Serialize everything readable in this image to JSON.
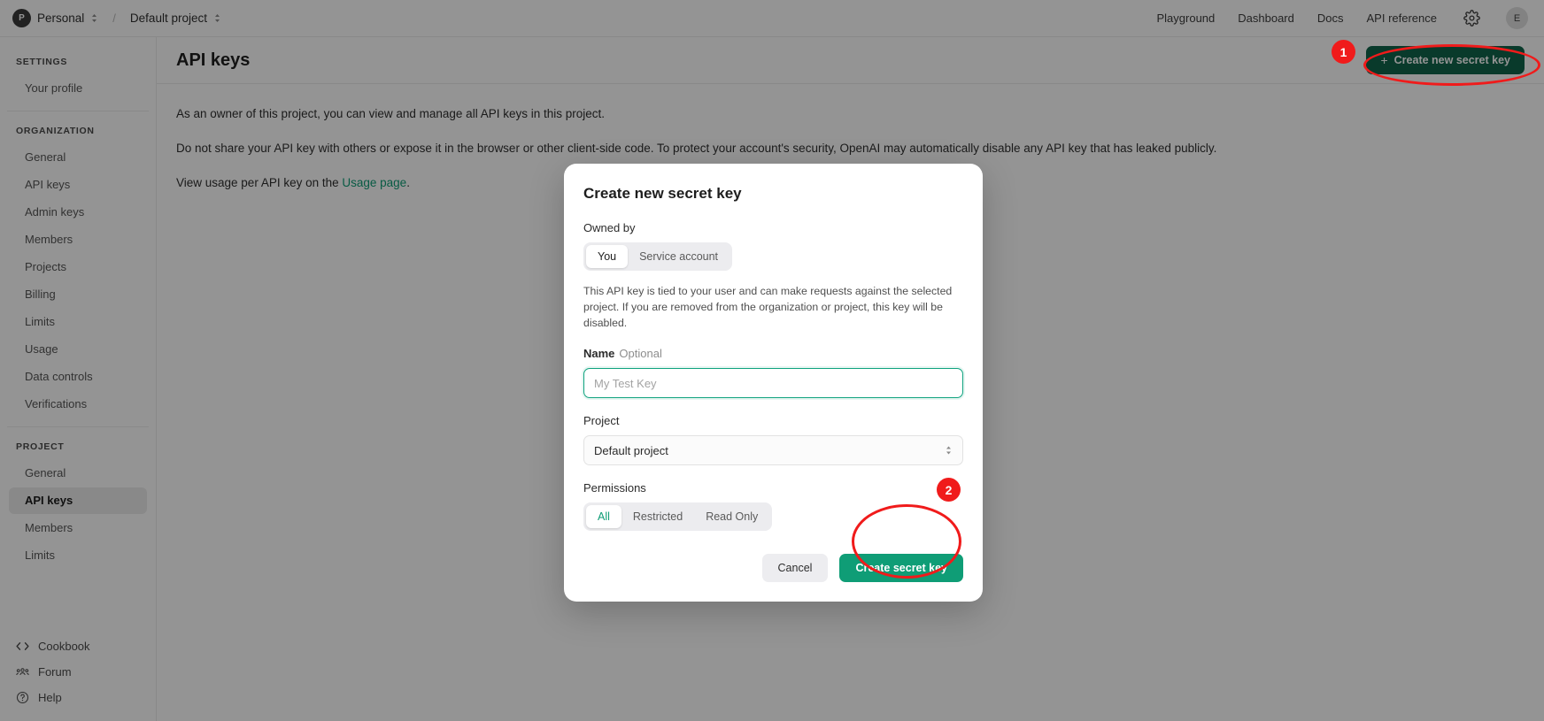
{
  "topbar": {
    "org_avatar_letter": "P",
    "org_name": "Personal",
    "separator": "/",
    "project_name": "Default project",
    "nav": [
      {
        "label": "Playground"
      },
      {
        "label": "Dashboard"
      },
      {
        "label": "Docs"
      },
      {
        "label": "API reference"
      }
    ],
    "settings_icon": "gear-icon",
    "user_avatar_letter": "E"
  },
  "sidebar": {
    "settings_title": "SETTINGS",
    "settings_items": [
      {
        "label": "Your profile"
      }
    ],
    "organization_title": "ORGANIZATION",
    "organization_items": [
      {
        "label": "General"
      },
      {
        "label": "API keys"
      },
      {
        "label": "Admin keys"
      },
      {
        "label": "Members"
      },
      {
        "label": "Projects"
      },
      {
        "label": "Billing"
      },
      {
        "label": "Limits"
      },
      {
        "label": "Usage"
      },
      {
        "label": "Data controls"
      },
      {
        "label": "Verifications"
      }
    ],
    "project_title": "PROJECT",
    "project_items": [
      {
        "label": "General",
        "active": false
      },
      {
        "label": "API keys",
        "active": true
      },
      {
        "label": "Members",
        "active": false
      },
      {
        "label": "Limits",
        "active": false
      }
    ],
    "footer_items": [
      {
        "label": "Cookbook",
        "icon": "code-icon"
      },
      {
        "label": "Forum",
        "icon": "people-icon"
      },
      {
        "label": "Help",
        "icon": "question-circle-icon"
      }
    ]
  },
  "main": {
    "title": "API keys",
    "create_button": {
      "label": "Create new secret key",
      "plus": "+"
    },
    "paragraph_1": "As an owner of this project, you can view and manage all API keys in this project.",
    "paragraph_2": "Do not share your API key with others or expose it in the browser or other client-side code. To protect your account's security, OpenAI may automatically disable any API key that has leaked publicly.",
    "paragraph_3_prefix": "View usage per API key on the ",
    "paragraph_3_link": "Usage page",
    "paragraph_3_suffix": "."
  },
  "modal": {
    "title": "Create new secret key",
    "owned_by_label": "Owned by",
    "owned_by_options": [
      {
        "label": "You",
        "selected": true
      },
      {
        "label": "Service account",
        "selected": false
      }
    ],
    "helper_text": "This API key is tied to your user and can make requests against the selected project. If you are removed from the organization or project, this key will be disabled.",
    "name_label": "Name",
    "name_optional": "Optional",
    "name_value": "",
    "name_placeholder": "My Test Key",
    "project_label": "Project",
    "project_value": "Default project",
    "permissions_label": "Permissions",
    "permissions_options": [
      {
        "label": "All",
        "selected": true
      },
      {
        "label": "Restricted",
        "selected": false
      },
      {
        "label": "Read Only",
        "selected": false
      }
    ],
    "cancel_label": "Cancel",
    "submit_label": "Create secret key"
  },
  "annotations": [
    {
      "number": "1"
    },
    {
      "number": "2"
    }
  ],
  "colors": {
    "brand_green": "#0f9d76",
    "dark_green_button": "#10644a",
    "annotation_red": "#f01b1b",
    "active_nav_bg": "#ededed"
  }
}
